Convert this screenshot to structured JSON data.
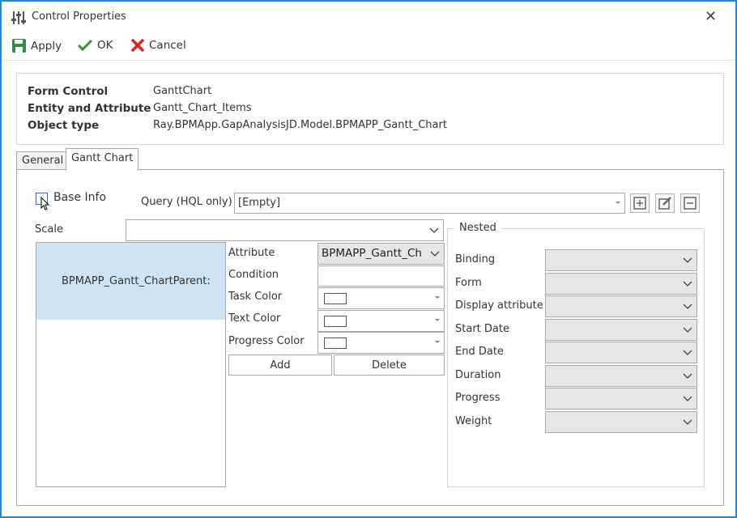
{
  "window": {
    "title": "Control Properties",
    "close_glyph": "✕"
  },
  "toolbar": {
    "apply_label": "Apply",
    "ok_label": "OK",
    "cancel_label": "Cancel"
  },
  "info": {
    "form_control_label": "Form Control",
    "form_control_value": "GanttChart",
    "entity_label": "Entity and Attribute",
    "entity_value": "Gantt_Chart_Items",
    "object_type_label": "Object type",
    "object_type_value": "Ray.BPMApp.GapAnalysisJD.Model.BPMAPP_Gantt_Chart"
  },
  "tabs": [
    {
      "label": "General"
    },
    {
      "label": "Gantt Chart"
    }
  ],
  "gantt": {
    "base_info_label": "Base Info",
    "query_label": "Query (HQL only)",
    "query_value": "[Empty]",
    "scale_label": "Scale",
    "scale_value": "",
    "tree_item": "BPMAPP_Gantt_ChartParent:",
    "attribute_label": "Attribute",
    "attribute_value": "BPMAPP_Gantt_Ch",
    "condition_label": "Condition",
    "condition_value": "",
    "task_color_label": "Task Color",
    "text_color_label": "Text Color",
    "progress_color_label": "Progress Color",
    "add_label": "Add",
    "delete_label": "Delete"
  },
  "nested": {
    "title": "Nested",
    "fields": [
      {
        "label": "Binding"
      },
      {
        "label": "Form"
      },
      {
        "label": "Display attribute"
      },
      {
        "label": "Start Date"
      },
      {
        "label": "End Date"
      },
      {
        "label": "Duration"
      },
      {
        "label": "Progress"
      },
      {
        "label": "Weight"
      }
    ]
  },
  "colors": {
    "accent_border": "#1e88e5",
    "tree_selected": "#cfe3f3",
    "cancel_red": "#e02020",
    "ok_green": "#2e9a2e",
    "apply_green": "#2f8f3f"
  }
}
